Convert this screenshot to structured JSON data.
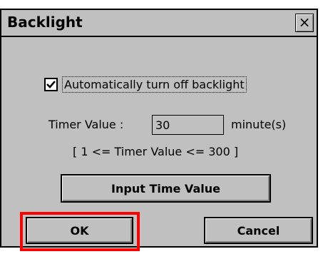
{
  "dialog": {
    "title": "Backlight",
    "close_glyph": "×"
  },
  "checkbox": {
    "label": "Automatically turn off backlight",
    "checked": true
  },
  "timer": {
    "label": "Timer Value :",
    "value": "30",
    "unit": "minute(s)"
  },
  "range_text": "[ 1 <= Timer Value <= 300 ]",
  "buttons": {
    "input_time_label": "Input Time Value",
    "ok_label": "OK",
    "cancel_label": "Cancel"
  },
  "highlight_color": "#ff0000"
}
